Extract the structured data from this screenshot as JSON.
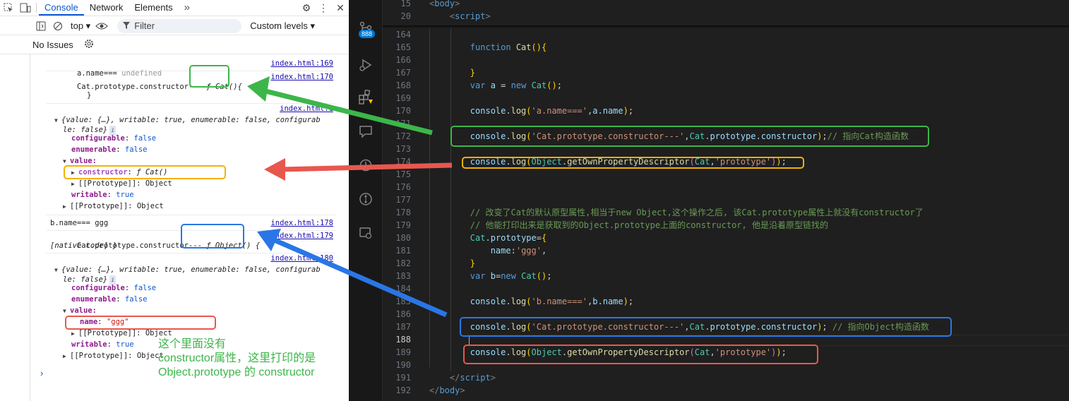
{
  "devtools": {
    "tabs": [
      "Console",
      "Network",
      "Elements",
      "»"
    ],
    "active_tab": "Console",
    "context": "top ▾",
    "filter_placeholder": "Filter",
    "levels": "Custom levels ▾",
    "issues": "No Issues",
    "console": {
      "l1": "a.name===",
      "l1v": "undefined",
      "l1src": "index.html:169",
      "l2": "Cat.prototype.constructor---",
      "l2v": "ƒ Cat(){",
      "l2src": "index.html:170",
      "l3": "}",
      "l4src": "index.html:1",
      "obj1_a": "{value: {…}, writable: true, enumerable: false, configurab",
      "obj1_b": "le: false}",
      "cfg": "configurable",
      "false": "false",
      "enu": "enumerable",
      "val": "value:",
      "ctor_key": "constructor",
      "ctor_val": "ƒ Cat()",
      "proto": "[[Prototype]]: Object",
      "wr": "writable",
      "true": "true",
      "b1": "b.name=== ggg",
      "b1src": "index.html:178",
      "b2": "Cat.prototype.constructor---",
      "b2v": "ƒ Object() {",
      "b2b": "[native code] }",
      "b2src": "index.html:179",
      "b3src": "index.html:180",
      "name_key": "name",
      "name_val": "\"ggg\"",
      "prompt": "›",
      "badge": "i"
    }
  },
  "activity_badge": "888",
  "editor": {
    "sticky": [
      {
        "ln": "15",
        "html": "<span class='c-tag'>&lt;</span><span class='c-tagn'>body</span><span class='c-tag'>&gt;</span>"
      },
      {
        "ln": "20",
        "html": "    <span class='c-tag'>&lt;</span><span class='c-tagn'>script</span><span class='c-tag'>&gt;</span>"
      }
    ],
    "lines": [
      {
        "ln": "164",
        "html": ""
      },
      {
        "ln": "165",
        "html": "        <span class='c-kw'>function</span> <span class='c-fn'>Cat</span><span class='c-br1'>()</span><span class='c-br1'>{</span>"
      },
      {
        "ln": "166",
        "html": ""
      },
      {
        "ln": "167",
        "html": "        <span class='c-br1'>}</span>"
      },
      {
        "ln": "168",
        "html": "        <span class='c-kw'>var</span> <span class='c-var'>a</span> = <span class='c-kw'>new</span> <span class='c-cls'>Cat</span><span class='c-br1'>()</span>;"
      },
      {
        "ln": "169",
        "html": ""
      },
      {
        "ln": "170",
        "html": "        <span class='c-var'>console</span>.<span class='c-fn'>log</span><span class='c-br1'>(</span><span class='c-str'>'a.name==='</span>,<span class='c-var'>a</span>.<span class='c-var'>name</span><span class='c-br1'>)</span>;"
      },
      {
        "ln": "171",
        "html": ""
      },
      {
        "ln": "172",
        "html": "        <span class='c-var'>console</span>.<span class='c-fn'>log</span><span class='c-br1'>(</span><span class='c-str'>'Cat.prototype.constructor---'</span>,<span class='c-cls'>Cat</span>.<span class='c-var'>prototype</span>.<span class='c-var'>constructor</span><span class='c-br1'>)</span>;<span class='c-cm'>// 指向Cat构造函数</span>"
      },
      {
        "ln": "173",
        "html": ""
      },
      {
        "ln": "174",
        "html": "        <span class='c-var'>console</span>.<span class='c-fn'>log</span><span class='c-br1'>(</span><span class='c-cls'>Object</span>.<span class='c-fn'>getOwnPropertyDescriptor</span><span class='c-br2'>(</span><span class='c-cls'>Cat</span>,<span class='c-str'>'prototype'</span><span class='c-br2'>)</span><span class='c-br1'>)</span>;"
      },
      {
        "ln": "175",
        "html": ""
      },
      {
        "ln": "176",
        "html": ""
      },
      {
        "ln": "177",
        "html": ""
      },
      {
        "ln": "178",
        "html": "        <span class='c-cm'>// 改变了Cat的默认原型属性,相当于new Object,这个操作之后, 该Cat.prototype属性上就没有constructor了</span>"
      },
      {
        "ln": "179",
        "html": "        <span class='c-cm'>// 他能打印出来是获取到的Object.prototype上面的constructor, 他是沿着原型链找的</span>"
      },
      {
        "ln": "180",
        "html": "        <span class='c-cls'>Cat</span>.<span class='c-var'>prototype</span>=<span class='c-br1'>{</span>"
      },
      {
        "ln": "181",
        "html": "            <span class='c-var'>name</span>:<span class='c-str'>'ggg'</span>,"
      },
      {
        "ln": "182",
        "html": "        <span class='c-br1'>}</span>"
      },
      {
        "ln": "183",
        "html": "        <span class='c-kw'>var</span> <span class='c-var'>b</span>=<span class='c-kw'>new</span> <span class='c-cls'>Cat</span><span class='c-br1'>()</span>;"
      },
      {
        "ln": "184",
        "html": ""
      },
      {
        "ln": "185",
        "html": "        <span class='c-var'>console</span>.<span class='c-fn'>log</span><span class='c-br1'>(</span><span class='c-str'>'b.name==='</span>,<span class='c-var'>b</span>.<span class='c-var'>name</span><span class='c-br1'>)</span>;"
      },
      {
        "ln": "186",
        "html": ""
      },
      {
        "ln": "187",
        "html": "        <span class='c-var'>console</span>.<span class='c-fn'>log</span><span class='c-br1'>(</span><span class='c-str'>'Cat.prototype.constructor---'</span>,<span class='c-cls'>Cat</span>.<span class='c-var'>prototype</span>.<span class='c-var'>constructor</span><span class='c-br1'>)</span>; <span class='c-cm'>// 指向Object构造函数</span>"
      },
      {
        "ln": "188",
        "html": ""
      },
      {
        "ln": "189",
        "html": "        <span class='c-var'>console</span>.<span class='c-fn'>log</span><span class='c-br1'>(</span><span class='c-cls'>Object</span>.<span class='c-fn'>getOwnPropertyDescriptor</span><span class='c-br2'>(</span><span class='c-cls'>Cat</span>,<span class='c-str'>'prototype'</span><span class='c-br2'>)</span><span class='c-br1'>)</span>;"
      },
      {
        "ln": "190",
        "html": ""
      },
      {
        "ln": "191",
        "html": "    <span class='c-tag'>&lt;/</span><span class='c-tagn'>script</span><span class='c-tag'>&gt;</span>"
      },
      {
        "ln": "192",
        "html": "<span class='c-tag'>&lt;/</span><span class='c-tagn'>body</span><span class='c-tag'>&gt;</span>"
      }
    ],
    "current_line": "188"
  },
  "annotation": {
    "note": "这个里面没有\nconstructor属性，这里打印的是\nObject.prototype 的 constructor",
    "colors": {
      "green": "#3cb64a",
      "yellow": "#f5b100",
      "blue": "#2a76e6",
      "red": "#e8574e"
    }
  }
}
